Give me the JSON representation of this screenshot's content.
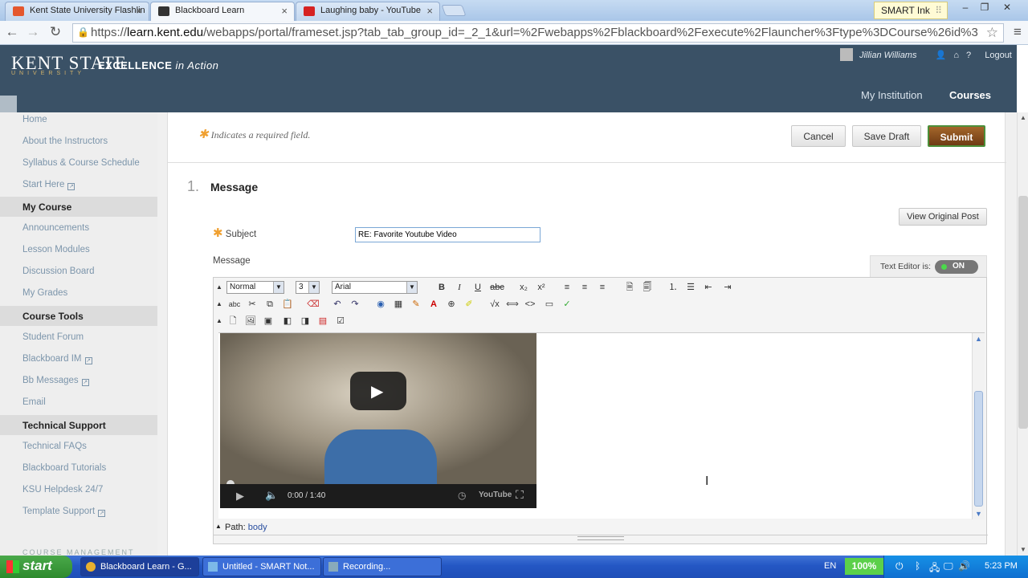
{
  "browser": {
    "tabs": [
      {
        "label": "Kent State University Flashlin",
        "fav_color": "#e4572e"
      },
      {
        "label": "Blackboard Learn",
        "fav_color": "#333333"
      },
      {
        "label": "Laughing baby - YouTube",
        "fav_color": "#d62222"
      }
    ],
    "smart_ink": "SMART Ink",
    "url_scheme": "https://",
    "url_host": "learn.kent.edu",
    "url_path": "/webapps/portal/frameset.jsp?tab_tab_group_id=_2_1&url=%2Fwebapps%2Fblackboard%2Fexecute%2Flauncher%3Ftype%3DCourse%26id%3"
  },
  "header": {
    "logo": "KENT STATE",
    "logo_sub": "UNIVERSITY",
    "tagline_bold": "EXCELLENCE",
    "tagline_italic": "in Action",
    "user_name": "Jillian Williams",
    "logout": "Logout",
    "tabs": [
      "My Institution",
      "Courses"
    ]
  },
  "sidebar": {
    "items_top": [
      "Home",
      "About the Instructors",
      "Syllabus & Course Schedule",
      "Start Here"
    ],
    "heading_course": "My Course",
    "items_course": [
      "Announcements",
      "Lesson Modules",
      "Discussion Board",
      "My Grades"
    ],
    "heading_tools": "Course Tools",
    "items_tools": [
      "Student Forum",
      "Blackboard IM",
      "Bb Messages",
      "Email"
    ],
    "heading_support": "Technical Support",
    "items_support": [
      "Technical FAQs",
      "Blackboard Tutorials",
      "KSU Helpdesk 24/7",
      "Template Support"
    ],
    "footer": "COURSE MANAGEMENT"
  },
  "form": {
    "required_note": "Indicates a required field.",
    "cancel": "Cancel",
    "save_draft": "Save Draft",
    "submit": "Submit",
    "section_number": "1.",
    "section_title": "Message",
    "view_original": "View Original Post",
    "subject_label": "Subject",
    "subject_value": "RE: Favorite Youtube Video",
    "message_label": "Message",
    "text_editor_label": "Text Editor is:",
    "text_editor_state": "ON"
  },
  "editor": {
    "format": "Normal",
    "size": "3",
    "font": "Arial",
    "path_label": "Path:",
    "path_value": "body",
    "video_time": "0:00 / 1:40"
  },
  "taskbar": {
    "start": "start",
    "tasks": [
      "Blackboard Learn - G...",
      "Untitled - SMART Not...",
      "Recording..."
    ],
    "lang": "EN",
    "zoom": "100%",
    "clock": "5:23 PM"
  }
}
